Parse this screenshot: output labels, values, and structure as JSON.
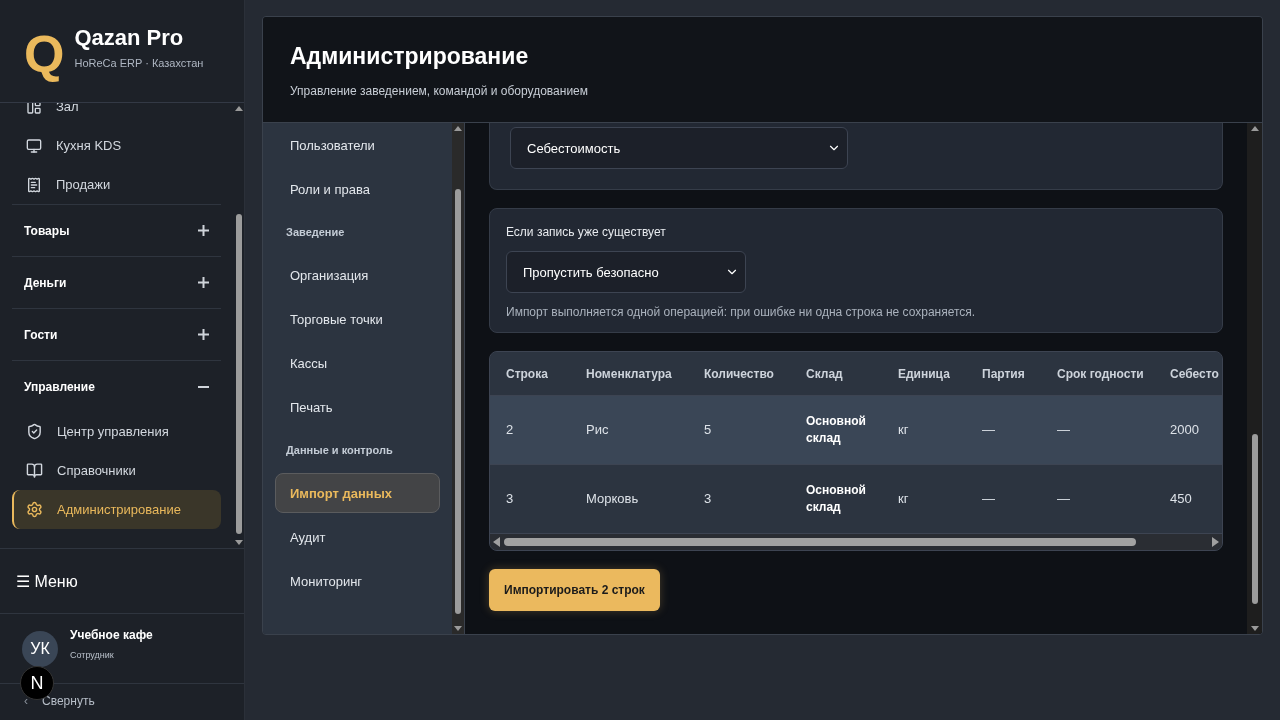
{
  "brand": {
    "logo": "Q",
    "name": "Qazan Pro",
    "tagline": "HoReCa ERP · Казахстан"
  },
  "sidebar": {
    "nav": [
      {
        "kind": "link",
        "label": "Зал",
        "selected": false
      },
      {
        "kind": "link",
        "label": "Кухня KDS",
        "selected": false
      },
      {
        "kind": "link",
        "label": "Продажи",
        "selected": false
      },
      {
        "kind": "group",
        "label": "Товары",
        "expanded": false
      },
      {
        "kind": "group",
        "label": "Деньги",
        "expanded": false
      },
      {
        "kind": "group",
        "label": "Гости",
        "expanded": false
      },
      {
        "kind": "group",
        "label": "Управление",
        "expanded": true,
        "children": [
          {
            "label": "Центр управления",
            "selected": false
          },
          {
            "label": "Справочники",
            "selected": false
          },
          {
            "label": "Администрирование",
            "selected": true
          }
        ]
      }
    ],
    "menu_button": "☰ Меню",
    "user": {
      "initials": "УК",
      "name": "Учебное кафе",
      "role": "Сотрудник"
    },
    "dev_badge": "N",
    "collapse": {
      "arrow": "‹",
      "label": "Свернуть"
    }
  },
  "page": {
    "title": "Администрирование",
    "subtitle": "Управление заведением, командой и оборудованием"
  },
  "subnav": [
    {
      "kind": "item",
      "label": "Пользователи",
      "selected": false
    },
    {
      "kind": "item",
      "label": "Роли и права",
      "selected": false
    },
    {
      "kind": "section",
      "label": "Заведение"
    },
    {
      "kind": "item",
      "label": "Организация",
      "selected": false
    },
    {
      "kind": "item",
      "label": "Торговые точки",
      "selected": false
    },
    {
      "kind": "item",
      "label": "Кассы",
      "selected": false
    },
    {
      "kind": "item",
      "label": "Печать",
      "selected": false
    },
    {
      "kind": "section",
      "label": "Данные и контроль"
    },
    {
      "kind": "item",
      "label": "Импорт данных",
      "selected": true
    },
    {
      "kind": "item",
      "label": "Аудит",
      "selected": false
    },
    {
      "kind": "item",
      "label": "Мониторинг",
      "selected": false
    }
  ],
  "mapping_select": {
    "value": "Себестоимость"
  },
  "duplicates": {
    "label": "Если запись уже существует",
    "value": "Пропустить безопасно",
    "note": "Импорт выполняется одной операцией: при ошибке ни одна строка не сохраняется."
  },
  "table": {
    "columns": [
      "Строка",
      "Номенклатура",
      "Количество",
      "Склад",
      "Единица",
      "Партия",
      "Срок годности",
      "Себесто"
    ],
    "rows": [
      {
        "highlighted": true,
        "cells": [
          "2",
          "Рис",
          "5",
          "Основной склад",
          "кг",
          "—",
          "—",
          "2000"
        ]
      },
      {
        "highlighted": false,
        "cells": [
          "3",
          "Морковь",
          "3",
          "Основной склад",
          "кг",
          "—",
          "—",
          "450"
        ]
      }
    ]
  },
  "import_button": "Импортировать 2 строк"
}
